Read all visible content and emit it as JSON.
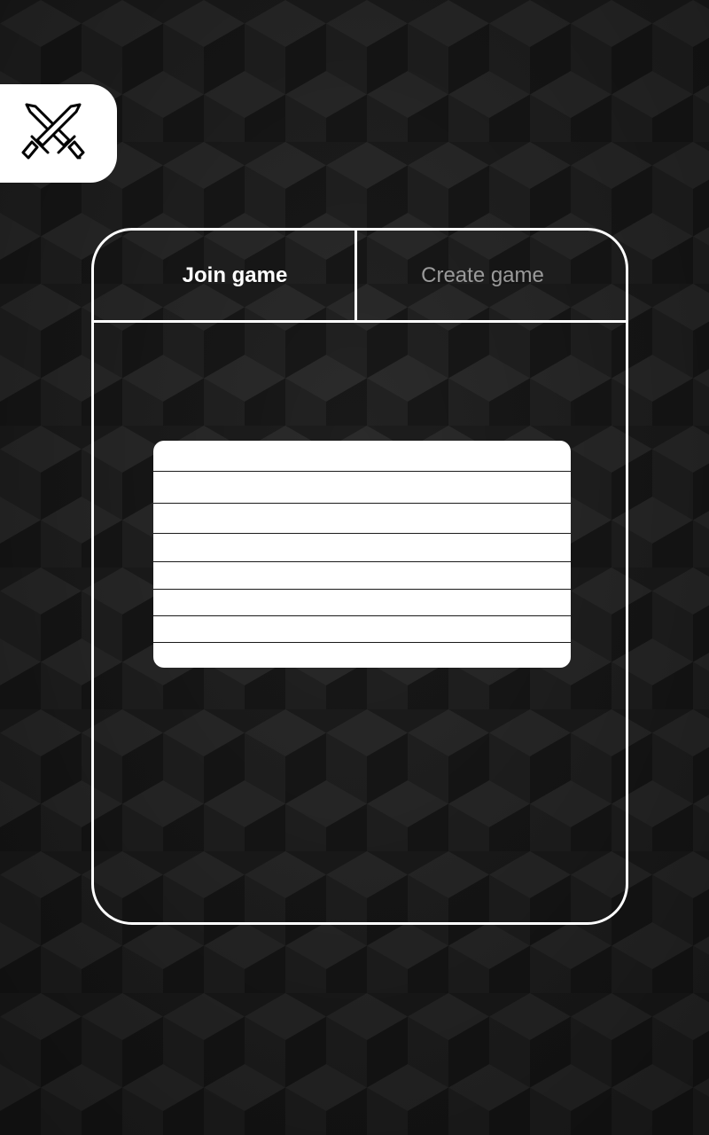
{
  "header": {
    "logo_icon": "crossed-swords-icon"
  },
  "tabs": [
    {
      "label": "Join game",
      "active": true
    },
    {
      "label": "Create game",
      "active": false
    }
  ],
  "game_list": {
    "rows": [
      "",
      "",
      "",
      "",
      "",
      "",
      "",
      ""
    ]
  },
  "colors": {
    "background": "#1f1f1f",
    "panel_border": "#ffffff",
    "active_tab_text": "#ffffff",
    "inactive_tab_text": "#9a9a9a",
    "list_background": "#ffffff"
  }
}
